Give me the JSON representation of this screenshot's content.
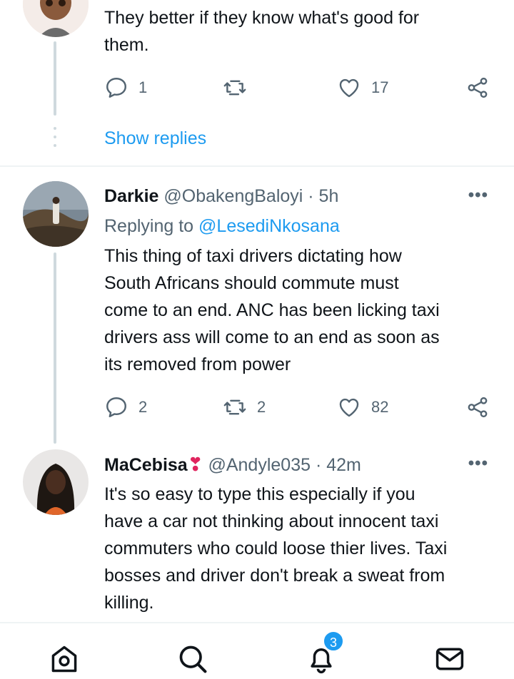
{
  "tweets": [
    {
      "text_lines": [
        "They better if they know what's good for",
        "them."
      ],
      "replies": "1",
      "retweets": "",
      "likes": "17"
    },
    {
      "name": "Darkie",
      "handle": "@ObakengBaloyi · 5h",
      "replying_prefix": "Replying to ",
      "replying_to": "@LesediNkosana",
      "text_lines": [
        "This thing of taxi drivers dictating how",
        "South Africans should commute must",
        "come to an end. ANC has been licking taxi",
        "drivers ass will come to an end as soon as",
        "its removed from power"
      ],
      "replies": "2",
      "retweets": "2",
      "likes": "82"
    },
    {
      "name": "MaCebisa",
      "emoji": "❣",
      "handle": "@Andyle035 · 42m",
      "text_lines": [
        "It's so easy to type this especially if you",
        "have a car not thinking about innocent taxi",
        "commuters who could loose thier lives. Taxi",
        "bosses and driver don't break a sweat from",
        "killing."
      ]
    }
  ],
  "show_replies": "Show replies",
  "more_glyph": "•••",
  "bottom_nav": {
    "notifications_badge": "3"
  },
  "colors": {
    "accent": "#1d9bf0",
    "text": "#0f1419",
    "muted": "#536471",
    "heart_emoji": "#e0245e"
  },
  "icons": [
    "reply-icon",
    "retweet-icon",
    "like-icon",
    "share-icon",
    "more-icon",
    "home-icon",
    "search-icon",
    "bell-icon",
    "mail-icon"
  ]
}
